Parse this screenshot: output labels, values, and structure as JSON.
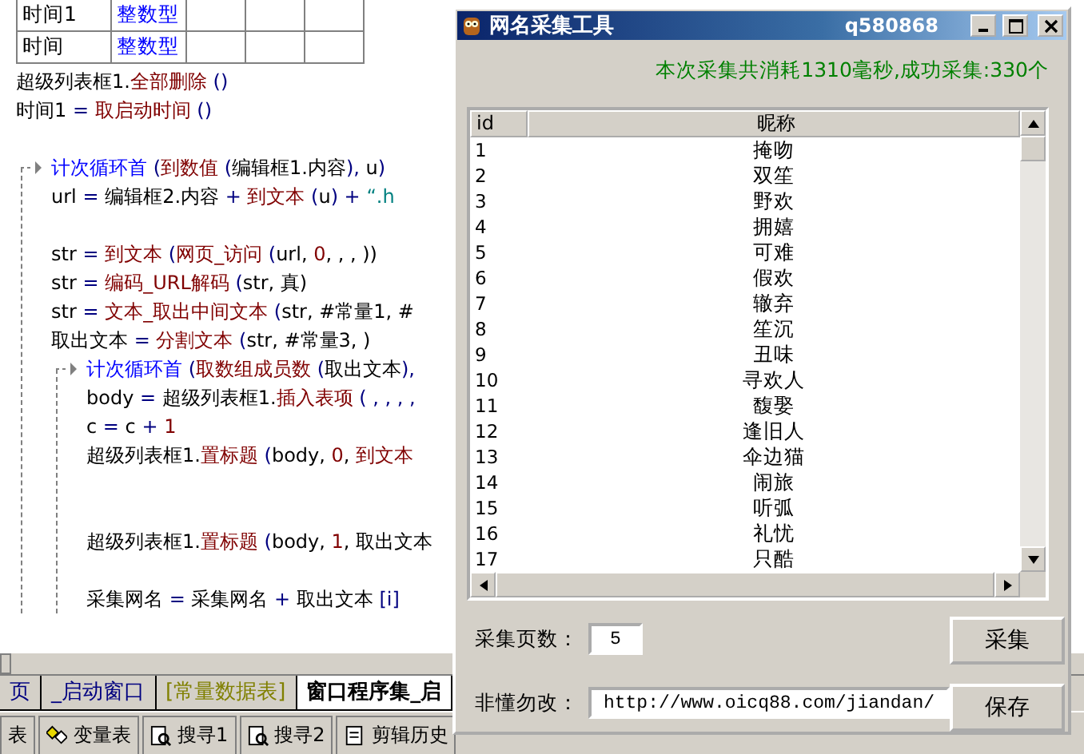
{
  "var_table": {
    "rows": [
      {
        "name": "时间1",
        "type": "整数型"
      },
      {
        "name": "时间",
        "type": "整数型"
      }
    ]
  },
  "code": [
    {
      "kind": "line",
      "tokens": [
        {
          "kind": "plain",
          "text": "超级列表框1."
        },
        {
          "kind": "func",
          "text": "全部删除"
        },
        {
          "kind": "sym",
          "text": " ()"
        }
      ]
    },
    {
      "kind": "line",
      "tokens": [
        {
          "kind": "plain",
          "text": "时间1"
        },
        {
          "kind": "sym",
          "text": " = "
        },
        {
          "kind": "func",
          "text": "取启动时间"
        },
        {
          "kind": "sym",
          "text": " ()"
        }
      ]
    },
    {
      "kind": "blank"
    },
    {
      "kind": "loop",
      "tokens": [
        {
          "kind": "flow",
          "text": "计次循环首"
        },
        {
          "kind": "sym",
          "text": " ("
        },
        {
          "kind": "func",
          "text": "到数值"
        },
        {
          "kind": "sym",
          "text": " ("
        },
        {
          "kind": "plain",
          "text": "编辑框1.内容"
        },
        {
          "kind": "sym",
          "text": "), "
        },
        {
          "kind": "plain",
          "text": "u"
        },
        {
          "kind": "sym",
          "text": ")"
        }
      ],
      "children": [
        {
          "kind": "line",
          "tokens": [
            {
              "kind": "plain",
              "text": "url"
            },
            {
              "kind": "sym",
              "text": " = "
            },
            {
              "kind": "plain",
              "text": "编辑框2.内容"
            },
            {
              "kind": "sym",
              "text": " + "
            },
            {
              "kind": "func",
              "text": "到文本"
            },
            {
              "kind": "sym",
              "text": " ("
            },
            {
              "kind": "plain",
              "text": "u"
            },
            {
              "kind": "sym",
              "text": ") + "
            },
            {
              "kind": "str",
              "text": "“.h"
            }
          ]
        },
        {
          "kind": "blank"
        },
        {
          "kind": "line",
          "tokens": [
            {
              "kind": "plain",
              "text": "str"
            },
            {
              "kind": "sym",
              "text": " = "
            },
            {
              "kind": "func",
              "text": "到文本"
            },
            {
              "kind": "sym",
              "text": " ("
            },
            {
              "kind": "func",
              "text": "网页_访问"
            },
            {
              "kind": "sym",
              "text": " ("
            },
            {
              "kind": "plain",
              "text": "url, "
            },
            {
              "kind": "num",
              "text": "0"
            },
            {
              "kind": "plain",
              "text": ", , , ))"
            }
          ]
        },
        {
          "kind": "line",
          "tokens": [
            {
              "kind": "plain",
              "text": "str"
            },
            {
              "kind": "sym",
              "text": " = "
            },
            {
              "kind": "func",
              "text": "编码_URL解码"
            },
            {
              "kind": "sym",
              "text": " ("
            },
            {
              "kind": "plain",
              "text": "str, 真)"
            }
          ]
        },
        {
          "kind": "line",
          "tokens": [
            {
              "kind": "plain",
              "text": "str"
            },
            {
              "kind": "sym",
              "text": " = "
            },
            {
              "kind": "func",
              "text": "文本_取出中间文本"
            },
            {
              "kind": "sym",
              "text": " ("
            },
            {
              "kind": "plain",
              "text": "str, #常量1, #"
            }
          ]
        },
        {
          "kind": "line",
          "tokens": [
            {
              "kind": "plain",
              "text": "取出文本"
            },
            {
              "kind": "sym",
              "text": " = "
            },
            {
              "kind": "func",
              "text": "分割文本"
            },
            {
              "kind": "sym",
              "text": " ("
            },
            {
              "kind": "plain",
              "text": "str, #常量3, )"
            }
          ]
        },
        {
          "kind": "loop",
          "tokens": [
            {
              "kind": "flow",
              "text": "计次循环首"
            },
            {
              "kind": "sym",
              "text": " ("
            },
            {
              "kind": "func",
              "text": "取数组成员数"
            },
            {
              "kind": "sym",
              "text": " ("
            },
            {
              "kind": "plain",
              "text": "取出文本"
            },
            {
              "kind": "sym",
              "text": "),"
            }
          ],
          "children": [
            {
              "kind": "line",
              "tokens": [
                {
                  "kind": "plain",
                  "text": "body"
                },
                {
                  "kind": "sym",
                  "text": " = "
                },
                {
                  "kind": "plain",
                  "text": "超级列表框1."
                },
                {
                  "kind": "func",
                  "text": "插入表项"
                },
                {
                  "kind": "sym",
                  "text": " ( , , , ,"
                }
              ]
            },
            {
              "kind": "line",
              "tokens": [
                {
                  "kind": "plain",
                  "text": "c"
                },
                {
                  "kind": "sym",
                  "text": " = "
                },
                {
                  "kind": "plain",
                  "text": "c"
                },
                {
                  "kind": "sym",
                  "text": " + "
                },
                {
                  "kind": "num",
                  "text": "1"
                }
              ]
            },
            {
              "kind": "line",
              "tokens": [
                {
                  "kind": "plain",
                  "text": "超级列表框1."
                },
                {
                  "kind": "func",
                  "text": "置标题"
                },
                {
                  "kind": "sym",
                  "text": " ("
                },
                {
                  "kind": "plain",
                  "text": "body, "
                },
                {
                  "kind": "num",
                  "text": "0"
                },
                {
                  "kind": "plain",
                  "text": ", "
                },
                {
                  "kind": "func",
                  "text": "到文本"
                }
              ]
            },
            {
              "kind": "blank"
            },
            {
              "kind": "blank"
            },
            {
              "kind": "line",
              "tokens": [
                {
                  "kind": "plain",
                  "text": "超级列表框1."
                },
                {
                  "kind": "func",
                  "text": "置标题"
                },
                {
                  "kind": "sym",
                  "text": " ("
                },
                {
                  "kind": "plain",
                  "text": "body, "
                },
                {
                  "kind": "num",
                  "text": "1"
                },
                {
                  "kind": "plain",
                  "text": ", 取出文本"
                }
              ]
            },
            {
              "kind": "blank"
            },
            {
              "kind": "line",
              "tokens": [
                {
                  "kind": "plain",
                  "text": "采集网名"
                },
                {
                  "kind": "sym",
                  "text": " = "
                },
                {
                  "kind": "plain",
                  "text": "采集网名"
                },
                {
                  "kind": "sym",
                  "text": " + "
                },
                {
                  "kind": "plain",
                  "text": "取出文本 "
                },
                {
                  "kind": "sym",
                  "text": "[i]"
                }
              ]
            }
          ]
        }
      ]
    }
  ],
  "editor_tabs": [
    {
      "label": "页",
      "selected": false,
      "color": "#000080"
    },
    {
      "label": "_启动窗口",
      "selected": false,
      "color": "#000080"
    },
    {
      "label": "[常量数据表]",
      "selected": false,
      "color": "#808000"
    },
    {
      "label": "窗口程序集_启",
      "selected": true,
      "color": "#000000"
    }
  ],
  "bottom_toolbar": [
    {
      "kind": "none",
      "label": "表"
    },
    {
      "kind": "variables",
      "label": "变量表"
    },
    {
      "kind": "search",
      "label": "搜寻1"
    },
    {
      "kind": "search",
      "label": "搜寻2"
    },
    {
      "kind": "clipboard",
      "label": "剪辑历史"
    }
  ],
  "dialog": {
    "title": "网名采集工具",
    "title_right": "q580868",
    "status": "本次采集共消耗1310毫秒,成功采集:330个",
    "table": {
      "columns": [
        "id",
        "昵称"
      ],
      "rows": [
        {
          "id": "1",
          "name": "掩吻"
        },
        {
          "id": "2",
          "name": "双笙"
        },
        {
          "id": "3",
          "name": "野欢"
        },
        {
          "id": "4",
          "name": "拥嬉"
        },
        {
          "id": "5",
          "name": "可难"
        },
        {
          "id": "6",
          "name": "假欢"
        },
        {
          "id": "7",
          "name": "辙弃"
        },
        {
          "id": "8",
          "name": "笙沉"
        },
        {
          "id": "9",
          "name": "丑味"
        },
        {
          "id": "10",
          "name": "寻欢人"
        },
        {
          "id": "11",
          "name": "馥娶"
        },
        {
          "id": "12",
          "name": "逢旧人"
        },
        {
          "id": "13",
          "name": "伞边猫"
        },
        {
          "id": "14",
          "name": "闹旅"
        },
        {
          "id": "15",
          "name": "听弧"
        },
        {
          "id": "16",
          "name": "礼忧"
        },
        {
          "id": "17",
          "name": "只酷"
        }
      ]
    },
    "pages_label": "采集页数：",
    "pages_value": "5",
    "url_label": "非懂勿改：",
    "url_value": "http://www.oicq88.com/jiandan/",
    "buttons": [
      "采集",
      "保存"
    ]
  }
}
